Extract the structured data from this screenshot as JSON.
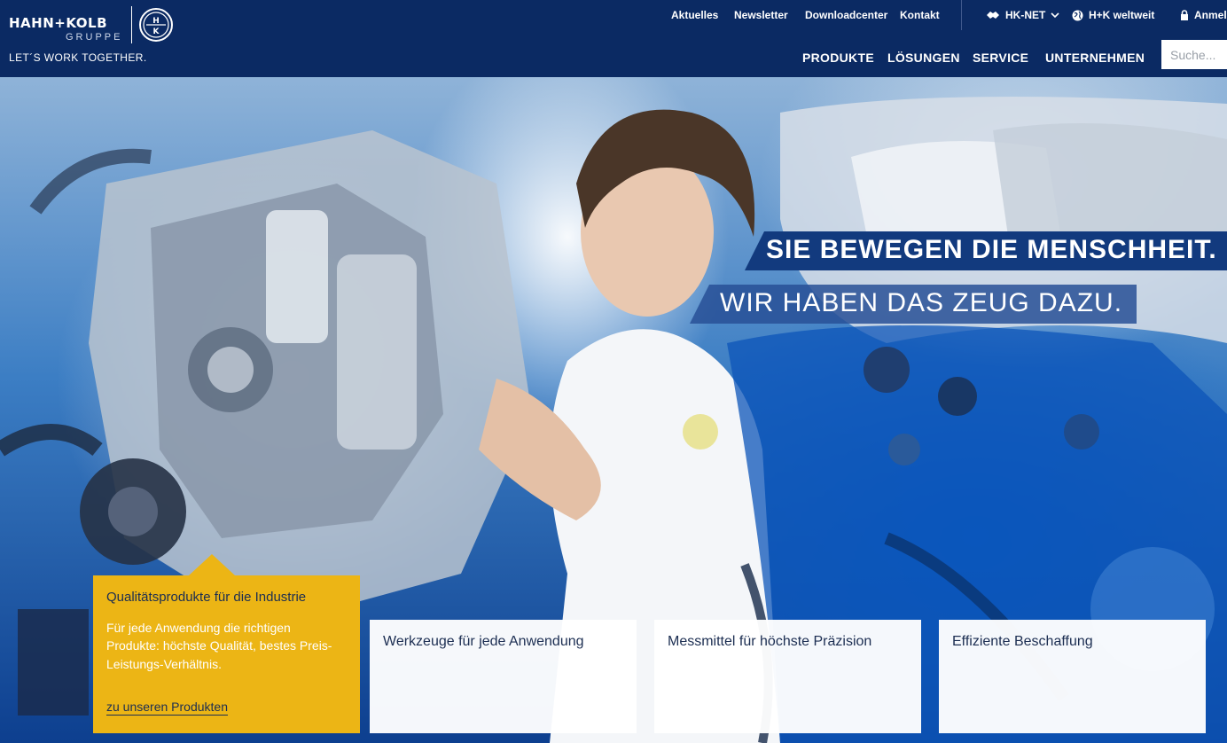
{
  "brand": {
    "logo_text": "HAHN+KOLB",
    "logo_sub": "GRUPPE",
    "emblem_text": "HK",
    "slogan": "LET´S WORK TOGETHER."
  },
  "top_nav": [
    {
      "label": "Aktuelles"
    },
    {
      "label": "Newsletter"
    },
    {
      "label": "Downloadcenter"
    },
    {
      "label": "Kontakt"
    }
  ],
  "utility": {
    "hknet": "HK-NET",
    "worldwide": "H+K weltweit",
    "login": "Anmelden"
  },
  "main_nav": [
    {
      "label": "PRODUKTE"
    },
    {
      "label": "LÖSUNGEN"
    },
    {
      "label": "SERVICE"
    },
    {
      "label": "UNTERNEHMEN"
    }
  ],
  "search": {
    "placeholder": "Suche...",
    "value": ""
  },
  "hero": {
    "headline_1": "SIE BEWEGEN DIE MENSCHHEIT.",
    "headline_2": "WIR HABEN DAS ZEUG DAZU."
  },
  "cards": {
    "featured": {
      "title": "Qualitätsprodukte für die Industrie",
      "text": "Für jede Anwendung die richtigen Produkte: höchste Qualität, bestes Preis-Leistungs-Verhältnis.",
      "link": "zu unseren Produkten"
    },
    "items": [
      {
        "title": "Werkzeuge für jede Anwendung"
      },
      {
        "title": "Messmittel für höchste Präzision"
      },
      {
        "title": "Effiziente Beschaffung"
      }
    ]
  },
  "colors": {
    "header_bg": "#0b2a63",
    "accent_yellow": "#ecb515",
    "headline_bg": "#123a7e",
    "text_dark": "#1c2e52"
  }
}
